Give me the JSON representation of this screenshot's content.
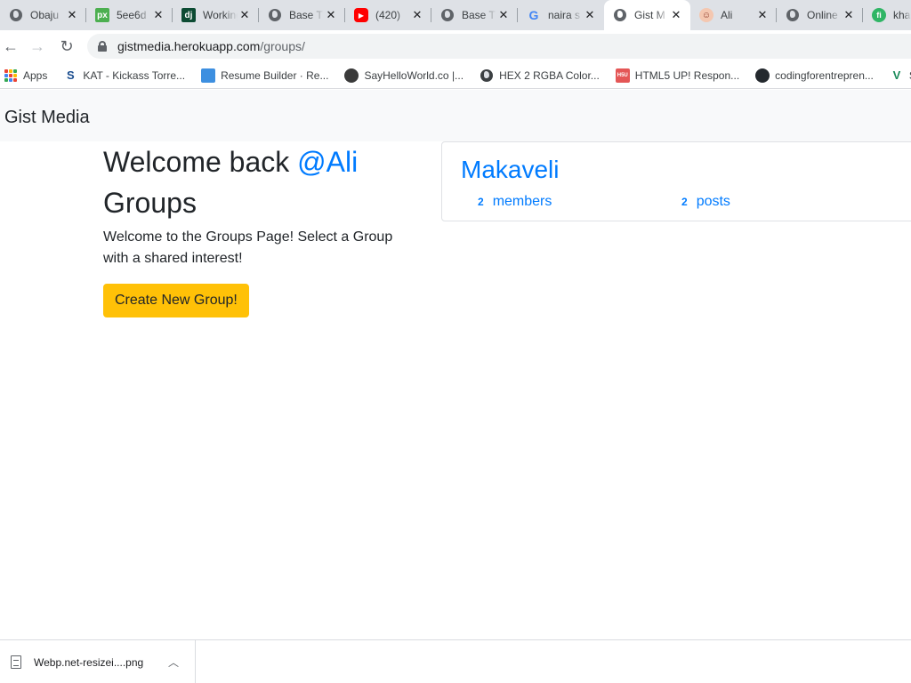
{
  "browser": {
    "tabs": [
      {
        "title": "Obaju",
        "icon": "globe-icon"
      },
      {
        "title": "5ee6d",
        "icon": "px-icon"
      },
      {
        "title": "Working",
        "icon": "django-icon"
      },
      {
        "title": "Base T",
        "icon": "globe-icon"
      },
      {
        "title": "(420)",
        "icon": "youtube-icon"
      },
      {
        "title": "Base T",
        "icon": "globe-icon"
      },
      {
        "title": "naira s",
        "icon": "google-icon"
      },
      {
        "title": "Gist M",
        "icon": "globe-icon",
        "active": true
      },
      {
        "title": "Ali",
        "icon": "avatar-icon"
      },
      {
        "title": "Online",
        "icon": "globe-icon"
      },
      {
        "title": "kha",
        "icon": "fi-icon"
      }
    ],
    "url": {
      "domain": "gistmedia.herokuapp.com",
      "path": "/groups/"
    },
    "bookmarks": [
      {
        "label": "Apps",
        "icon": "apps-grid-icon"
      },
      {
        "label": "KAT - Kickass Torre...",
        "icon": "kat-icon"
      },
      {
        "label": "Resume Builder · Re...",
        "icon": "resume-icon"
      },
      {
        "label": "SayHelloWorld.co |...",
        "icon": "sayhello-icon"
      },
      {
        "label": "HEX 2 RGBA Color...",
        "icon": "globe-icon"
      },
      {
        "label": "HTML5 UP! Respon...",
        "icon": "html5up-icon"
      },
      {
        "label": "codingforentrepren...",
        "icon": "github-icon"
      },
      {
        "label": "S",
        "icon": "v-icon"
      }
    ]
  },
  "navbar": {
    "brand": "Gist Media"
  },
  "main": {
    "welcome_prefix": "Welcome back ",
    "username": "@Ali",
    "heading": "Groups",
    "intro": "Welcome to the Groups Page! Select a Group with a shared interest!",
    "create_button": "Create New Group!"
  },
  "groups": [
    {
      "name": "Makaveli",
      "members_count": "2",
      "members_label": "members",
      "posts_count": "2",
      "posts_label": "posts"
    }
  ],
  "downloads": [
    {
      "filename": "Webp.net-resizei....png"
    }
  ],
  "colors": {
    "link": "#007bff",
    "create_button": "#ffc107",
    "navbar_bg": "#f8f9fa",
    "tabstrip_bg": "#dee1e6"
  }
}
